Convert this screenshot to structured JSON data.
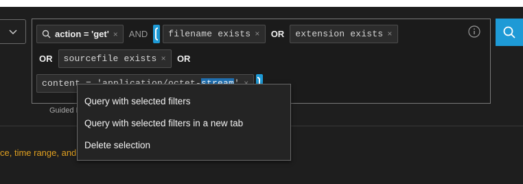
{
  "query": {
    "row1": {
      "pill_action": "action = 'get'",
      "op_and": "AND",
      "pill_filename": "filename exists",
      "op_or_1": "OR",
      "pill_extension": "extension exists"
    },
    "row2": {
      "op_or_2": "OR",
      "pill_sourcefile": "sourcefile exists",
      "op_or_3": "OR"
    },
    "row3": {
      "pill_content_prefix": "content = 'application/octet-",
      "pill_content_selected": "stream",
      "pill_content_suffix": "'"
    },
    "remove_glyph": "×"
  },
  "guided_label": "Guided M",
  "warning_text": "ce, time range, and edited query",
  "context_menu": {
    "items": [
      "Query with selected filters",
      "Query with selected filters in a new tab",
      "Delete selection"
    ]
  },
  "colors": {
    "accent": "#1e9ad6",
    "warning": "#e0a020",
    "selection": "#1f6fb0"
  },
  "icons": {
    "dropdown": "chevron-down-icon",
    "search_small": "search-icon",
    "info": "info-icon",
    "search_button": "search-icon"
  }
}
